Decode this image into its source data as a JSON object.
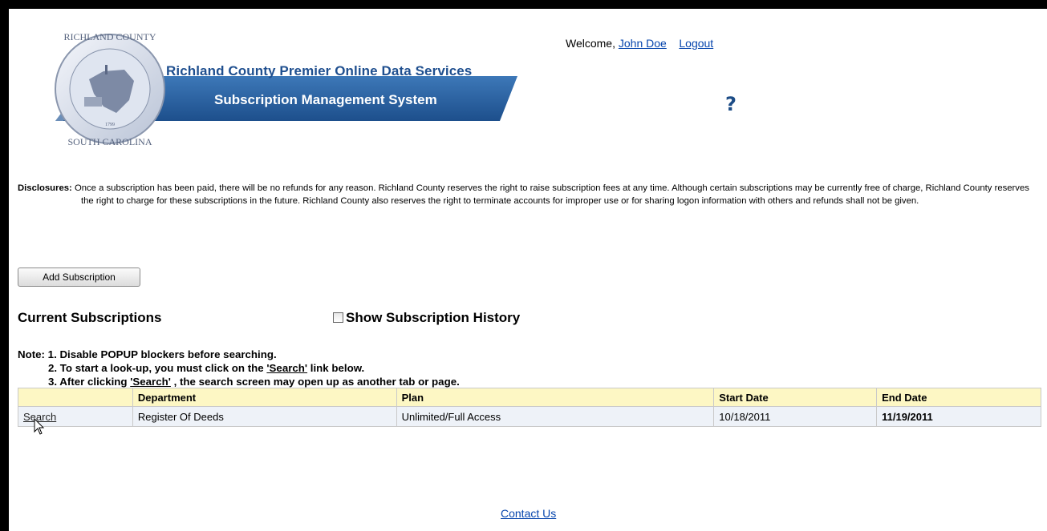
{
  "header": {
    "title": "Richland County Premier Online Data Services",
    "subtitle": "Subscription Management System",
    "seal": {
      "top_text": "RICHLAND COUNTY",
      "bottom_text": "SOUTH CAROLINA",
      "year": "1799"
    },
    "welcome_prefix": "Welcome,",
    "user_name": "John Doe",
    "logout_label": "Logout",
    "help_icon": "question-mark-icon"
  },
  "disclosures": {
    "label": "Disclosures:",
    "text": "Once a subscription has been paid, there will be no refunds for any reason. Richland County reserves the right to raise subscription fees at any time. Although certain subscriptions may be currently free of charge, Richland County reserves the right to charge for these subscriptions in the future. Richland County also reserves the right to terminate accounts for improper use or for sharing logon information with others and refunds shall not be given."
  },
  "actions": {
    "add_subscription_label": "Add Subscription"
  },
  "current": {
    "title": "Current Subscriptions",
    "show_history_label": "Show Subscription History",
    "show_history_checked": false
  },
  "notes": {
    "line1": "Note: 1. Disable POPUP blockers before searching.",
    "line2_prefix": "2. To start a look-up, you must click on the ",
    "line2_link": "'Search'",
    "line2_suffix": " link below.",
    "line3_prefix": "3. After clicking ",
    "line3_link": "'Search'",
    "line3_suffix": " , the search screen may open up as another tab or page."
  },
  "table": {
    "headers": [
      "",
      "Department",
      "Plan",
      "Start Date",
      "End Date"
    ],
    "rows": [
      {
        "action": "Search",
        "department": "Register Of Deeds",
        "plan": "Unlimited/Full Access",
        "start_date": "10/18/2011",
        "end_date": "11/19/2011"
      }
    ]
  },
  "footer": {
    "contact_label": "Contact Us"
  },
  "colors": {
    "banner_blue": "#1f4f8f",
    "link": "#0645ad",
    "header_row": "#fdf7c4",
    "data_row": "#eef2f8"
  }
}
